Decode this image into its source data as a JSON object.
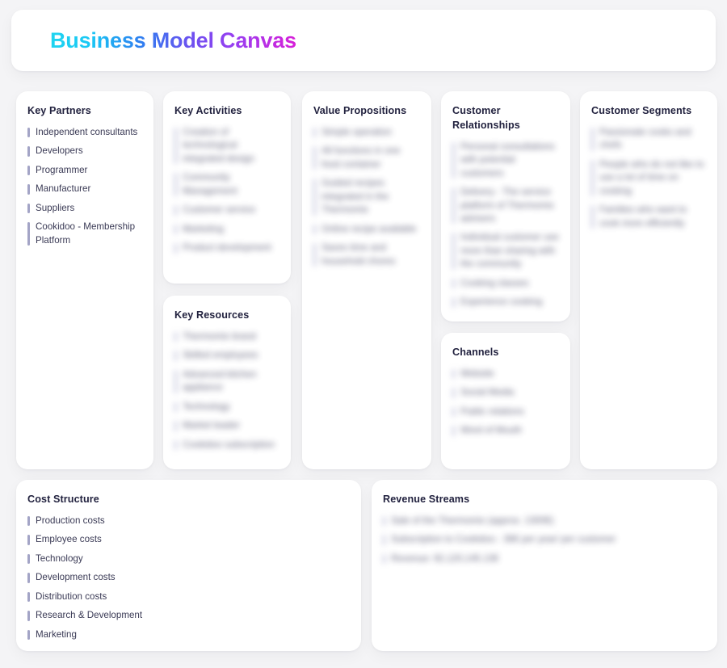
{
  "header": {
    "title": "Business Model Canvas",
    "gradient": [
      "#1fd4f0",
      "#2f7ef0",
      "#6f4ff0",
      "#d81fd8"
    ]
  },
  "theme": {
    "page_background": "#f4f4f6",
    "card_background": "#ffffff",
    "accent_bar": "#a3a4c6",
    "title_color": "#22223f",
    "item_color": "#3a3a55"
  },
  "blocks": {
    "key_partners": {
      "title": "Key Partners",
      "blurred": false,
      "items": [
        "Independent consultants",
        "Developers",
        "Programmer",
        "Manufacturer",
        "Suppliers",
        "Cookidoo - Membership Platform"
      ]
    },
    "key_activities": {
      "title": "Key Activities",
      "blurred": true,
      "items": [
        "Creation of technological integrated design",
        "Community Management",
        "Customer service",
        "Marketing",
        "Product development"
      ]
    },
    "key_resources": {
      "title": "Key Resources",
      "blurred": true,
      "items": [
        "Thermomix brand",
        "Skilled employees",
        "Advanced kitchen appliance",
        "Technology",
        "Market leader",
        "Cookidoo subscription"
      ]
    },
    "value_propositions": {
      "title": "Value Propositions",
      "blurred": true,
      "items": [
        "Simple operation",
        "All functions in one food container",
        "Guided recipes integrated in the Thermomix",
        "Online recipe available",
        "Saves time and household chores"
      ]
    },
    "customer_relationships": {
      "title": "Customer Relationships",
      "blurred": true,
      "items": [
        "Personal consultations with potential customers",
        "Delivery - The service platform of Thermomix advisers",
        "Individual customer use more than sharing with the community",
        "Cooking classes",
        "Experience cooking"
      ]
    },
    "channels": {
      "title": "Channels",
      "blurred": true,
      "items": [
        "Website",
        "Social Media",
        "Public relations",
        "Word of Mouth"
      ]
    },
    "customer_segments": {
      "title": "Customer Segments",
      "blurred": true,
      "items": [
        "Passionate cooks and chefs",
        "People who do not like to use a lot of time on cooking",
        "Families who want to cook more efficiently"
      ]
    },
    "cost_structure": {
      "title": "Cost Structure",
      "blurred": false,
      "items": [
        "Production costs",
        "Employee costs",
        "Technology",
        "Development costs",
        "Distribution costs",
        "Research & Development",
        "Marketing"
      ]
    },
    "revenue_streams": {
      "title": "Revenue Streams",
      "blurred": true,
      "items": [
        "Sale of the Thermomix (approx. 1300€)",
        "Subscription to Cookidoo - 36€ per year/ per customer",
        "Revenue: 92,120,145.13€"
      ]
    }
  }
}
